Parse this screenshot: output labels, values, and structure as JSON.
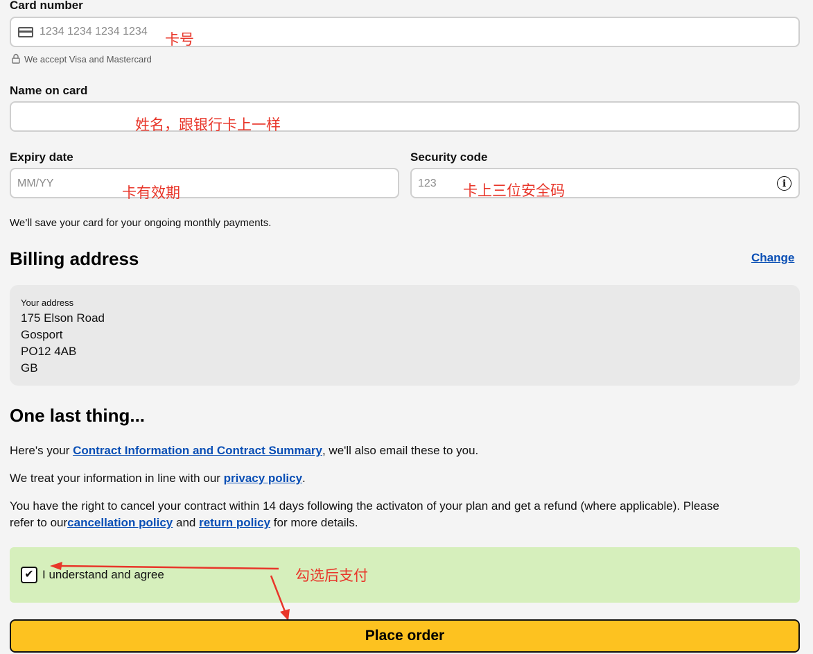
{
  "payment": {
    "card_number": {
      "label": "Card number",
      "placeholder": "1234 1234 1234 1234",
      "icon": "credit-card-icon",
      "note_icon": "lock-icon",
      "note": "We accept Visa and Mastercard"
    },
    "name_on_card": {
      "label": "Name on card",
      "value": ""
    },
    "expiry": {
      "label": "Expiry date",
      "placeholder": "MM/YY"
    },
    "security_code": {
      "label": "Security code",
      "placeholder": "123",
      "info_icon": "info-icon"
    },
    "save_note": "We’ll save your card for your ongoing monthly payments."
  },
  "billing": {
    "title": "Billing address",
    "change_link": "Change",
    "address_label": "Your address",
    "address_lines": [
      "175 Elson Road",
      "Gosport",
      "PO12 4AB",
      "GB"
    ]
  },
  "last_thing": {
    "title": "One last thing...",
    "p1_before": "Here's your ",
    "p1_link": "Contract Information and Contract Summary",
    "p1_after": ", we'll also email these to you.",
    "p2_before": "We treat your information in line with our ",
    "p2_link": "privacy policy",
    "p2_after": ".",
    "p3_line1": "You have the right to cancel your contract within 14 days following the activaton of your plan and get a refund (where applicable). Please",
    "p3_before": "refer to our",
    "p3_link1": "cancellation policy",
    "p3_mid": " and ",
    "p3_link2": "return policy",
    "p3_after": " for more details."
  },
  "agree": {
    "label": "I understand and agree",
    "checked": true
  },
  "place_order": "Place order",
  "annotations": {
    "card_number": "卡号",
    "name": "姓名，跟银行卡上一样",
    "expiry": "卡有效期",
    "security": "卡上三位安全码",
    "agree": "勾选后支付"
  },
  "colors": {
    "accent_yellow": "#fdc220",
    "link_blue": "#0a4fb5",
    "agree_green": "#d6efbc",
    "annotation_red": "#e8362a"
  }
}
